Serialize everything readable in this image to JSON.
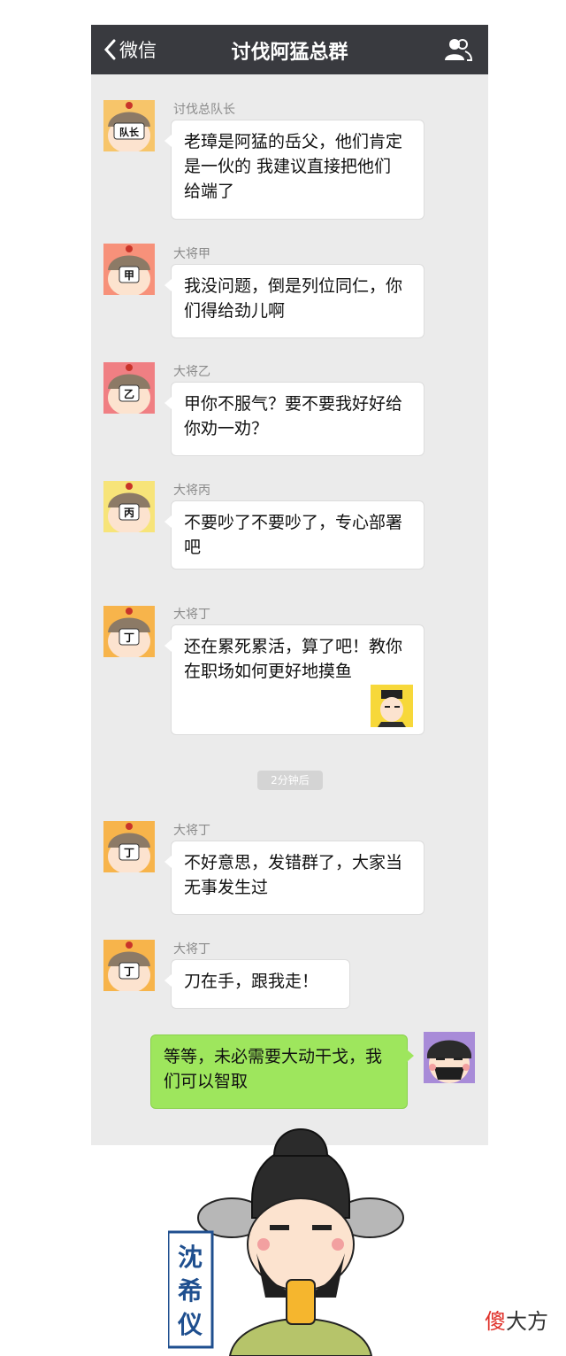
{
  "header": {
    "back_label": "微信",
    "title": "讨伐阿猛总群"
  },
  "messages": [
    {
      "sender": "讨伐总队长",
      "avatar_text": "队长",
      "avatar_bg": "#f7c56a",
      "text": [
        "老璋是阿猛的岳父，他们肯定",
        "是一伙的 我建议直接把他们",
        "给端了"
      ]
    },
    {
      "sender": "大将甲",
      "avatar_text": "甲",
      "avatar_bg": "#f7917a",
      "text": [
        "我没问题，倒是列位同仁，你",
        "们得给劲儿啊"
      ]
    },
    {
      "sender": "大将乙",
      "avatar_text": "乙",
      "avatar_bg": "#f07f83",
      "text": [
        "甲你不服气？要不要我好好给",
        "你劝一劝？"
      ]
    },
    {
      "sender": "大将丙",
      "avatar_text": "丙",
      "avatar_bg": "#f7e479",
      "text": [
        "不要吵了不要吵了，专心部署",
        "吧"
      ]
    },
    {
      "sender": "大将丁",
      "avatar_text": "丁",
      "avatar_bg": "#f7b44b",
      "text": [
        "还在累死累活，算了吧！教你",
        "在职场如何更好地摸鱼"
      ]
    },
    {
      "sender": "大将丁",
      "avatar_text": "丁",
      "avatar_bg": "#f7b44b",
      "text": [
        "不好意思，发错群了，大家当",
        "无事发生过"
      ]
    },
    {
      "sender": "大将丁",
      "avatar_text": "丁",
      "avatar_bg": "#f7b44b",
      "text": [
        "刀在手，跟我走！"
      ]
    }
  ],
  "time_divider": "2分钟后",
  "my_message": {
    "avatar_bg": "#a88bd8",
    "text": [
      "等等，未必需要大动干戈，我",
      "们可以智取"
    ]
  },
  "character": {
    "name_vertical": [
      "沈",
      "希",
      "仪"
    ]
  },
  "watermark": {
    "first": "傻",
    "rest": "大方"
  },
  "icons": [
    "chevron-left-icon",
    "group-members-icon"
  ]
}
